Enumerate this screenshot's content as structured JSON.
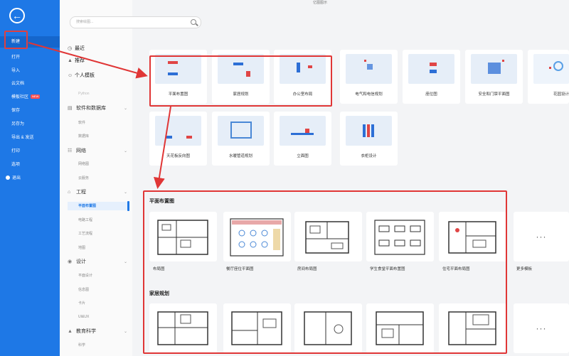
{
  "window_title": "亿图图示",
  "nav": {
    "items": [
      "新建",
      "打开",
      "导入",
      "云文档",
      "模板社区",
      "保存",
      "另存为",
      "导出 & 发送",
      "打印",
      "选项",
      "退出"
    ],
    "badge": "NEW"
  },
  "search": {
    "placeholder": "搜索绘图..."
  },
  "categories": {
    "top": [
      "最近",
      "推荐",
      "个人模板"
    ],
    "peek": "Python",
    "groups": [
      {
        "label": "软件和数据库",
        "subs": [
          "软件",
          "数据库"
        ]
      },
      {
        "label": "网络",
        "subs": [
          "网络图",
          "云服务"
        ]
      },
      {
        "label": "工程",
        "subs": [
          "平面布置图",
          "电路工程",
          "工艺流程",
          "地图"
        ]
      },
      {
        "label": "设计",
        "subs": [
          "平面设计",
          "信息图",
          "卡片",
          "UI&UX"
        ]
      },
      {
        "label": "教育科学",
        "subs": [
          "科学"
        ]
      }
    ]
  },
  "templates_row1": [
    "平面布置图",
    "家居规划",
    "办公室布局",
    "电气和电信规划",
    "座位图",
    "安全和门禁平面图",
    "花园设计"
  ],
  "templates_row2": [
    "天花板反向图",
    "水暖管道规划",
    "立面图",
    "衣柜设计"
  ],
  "section1": {
    "title": "平面布置图",
    "items": [
      "布局图",
      "餐厅座位平面图",
      "房间布局图",
      "学生食堂平面布置图",
      "住宅平面布局图"
    ],
    "more": "更多模板",
    "more_dots": "···"
  },
  "section2": {
    "title": "家居规划",
    "more_dots": "···"
  },
  "colors": {
    "brand_blue": "#1e78e6",
    "highlight_red": "#e03636"
  }
}
